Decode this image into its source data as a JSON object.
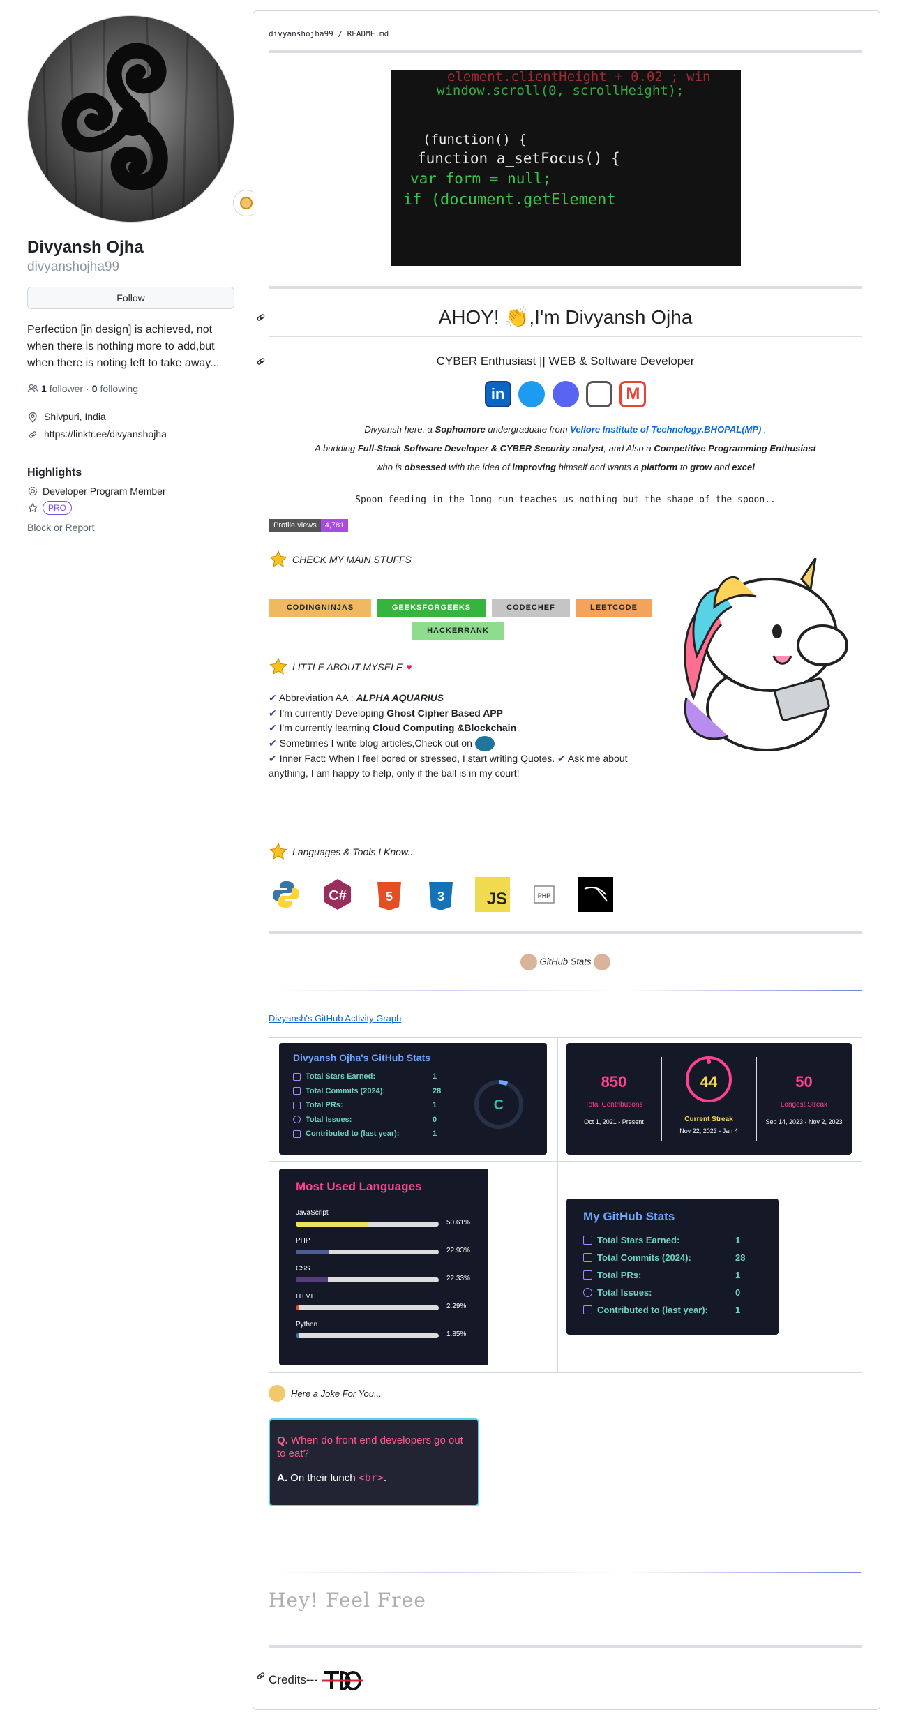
{
  "profile": {
    "full_name": "Divyansh Ojha",
    "login": "divyanshojha99",
    "follow_label": "Follow",
    "bio": "Perfection [in design] is achieved, not when there is nothing more to add,but when there is noting left to take away...",
    "followers_count": "1",
    "followers_label": "follower",
    "following_count": "0",
    "following_label": "following",
    "location": "Shivpuri, India",
    "website": "https://linktr.ee/divyanshojha",
    "highlights_title": "Highlights",
    "highlight_dev": "Developer Program Member",
    "pro_badge": "PRO",
    "block_label": "Block or Report"
  },
  "readme": {
    "breadcrumb_user": "divyanshojha99",
    "breadcrumb_sep": "/",
    "breadcrumb_file": "README.md",
    "code_lines": [
      "element.clientHeight + 0.02 ; win",
      "window.scroll(0, scrollHeight);",
      "(function() {",
      "function a_setFocus() {",
      "var form = null;",
      "if (document.getElement"
    ],
    "heading": "AHOY! 👏,I'm Divyansh Ojha",
    "subheading": "CYBER Enthusiast || WEB & Software Developer",
    "intro1_a": "Divyansh here, a ",
    "intro1_b": "Sophomore",
    "intro1_c": " undergraduate from ",
    "intro1_link": "Vellore Institute of Technology,BHOPAL(MP)",
    "intro1_d": " .",
    "intro2_a": "A budding ",
    "intro2_b": "Full-Stack Software Developer & CYBER Security analyst",
    "intro2_c": ", and Also a ",
    "intro2_d": "Competitive Programming Enthusiast",
    "intro3_a": "who is ",
    "intro3_b": "obsessed",
    "intro3_c": " with the idea of ",
    "intro3_d": "improving",
    "intro3_e": " himself and wants a ",
    "intro3_f": "platform",
    "intro3_g": " to ",
    "intro3_h": "grow",
    "intro3_i": " and ",
    "intro3_j": "excel",
    "quote": "Spoon feeding in the long run teaches us nothing but the shape of the spoon..",
    "views_label": "Profile views",
    "views_count": "4,781",
    "main_stuffs": "CHECK MY MAIN STUFFS",
    "badges": [
      "CODINGNINJAS",
      "GEEKSFORGEEKS",
      "CODECHEF",
      "LEETCODE",
      "HACKERRANK"
    ],
    "about_title": "LITTLE ABOUT MYSELF",
    "about_1a": "Abbreviation AA : ",
    "about_1b": "ALPHA AQUARIUS",
    "about_2a": "I'm currently Developing ",
    "about_2b": "Ghost Cipher Based APP",
    "about_3a": "I'm currently learning ",
    "about_3b": "Cloud Computing &Blockchain",
    "about_4": "Sometimes I write blog articles,Check out on",
    "about_5": "Inner Fact: When I feel bored or stressed, I start writing Quotes.",
    "about_6": "Ask me about anything, I am happy to help, only if the ball is in my court!",
    "tools_title": "Languages & Tools I Know...",
    "tools": [
      "Python",
      "C#",
      "HTML",
      "CSS",
      "JS",
      "PHP",
      "Kali"
    ],
    "github_stats": "GitHub Stats",
    "activity_link": "Divyansh's GitHub Activity Graph",
    "joke_title": "Here a Joke For You...",
    "joke_q_label": "Q.",
    "joke_q": "When do front end developers go out to eat?",
    "joke_a_label": "A.",
    "joke_a": "On their lunch",
    "joke_a_code": "<br>",
    "joke_a_end": ".",
    "hey": "Hey! Feel Free",
    "credits": "Credits---"
  },
  "stats_card": {
    "title": "Divyansh Ojha's GitHub Stats",
    "rows": [
      {
        "label": "Total Stars Earned:",
        "value": "1"
      },
      {
        "label": "Total Commits (2024):",
        "value": "28"
      },
      {
        "label": "Total PRs:",
        "value": "1"
      },
      {
        "label": "Total Issues:",
        "value": "0"
      },
      {
        "label": "Contributed to (last year):",
        "value": "1"
      }
    ],
    "grade": "C"
  },
  "streak_card": {
    "total": "850",
    "total_label": "Total Contributions",
    "total_range": "Oct 1, 2021 - Present",
    "current": "44",
    "current_label": "Current Streak",
    "current_range": "Nov 22, 2023 - Jan 4",
    "longest": "50",
    "longest_label": "Longest Streak",
    "longest_range": "Sep 14, 2023 - Nov 2, 2023"
  },
  "langs_card": {
    "title": "Most Used Languages",
    "langs": [
      {
        "name": "JavaScript",
        "pct": "50.61%",
        "frac": 0.5061,
        "color": "#f1e05a"
      },
      {
        "name": "PHP",
        "pct": "22.93%",
        "frac": 0.2293,
        "color": "#4f5d95"
      },
      {
        "name": "CSS",
        "pct": "22.33%",
        "frac": 0.2233,
        "color": "#563d7c"
      },
      {
        "name": "HTML",
        "pct": "2.29%",
        "frac": 0.0229,
        "color": "#e34c26"
      },
      {
        "name": "Python",
        "pct": "1.85%",
        "frac": 0.0185,
        "color": "#3572a5"
      }
    ]
  },
  "my_stats_card": {
    "title": "My GitHub Stats",
    "rows": [
      {
        "label": "Total Stars Earned:",
        "value": "1"
      },
      {
        "label": "Total Commits (2024):",
        "value": "28"
      },
      {
        "label": "Total PRs:",
        "value": "1"
      },
      {
        "label": "Total Issues:",
        "value": "0"
      },
      {
        "label": "Contributed to (last year):",
        "value": "1"
      }
    ]
  },
  "colors": {
    "stats_title": "#70a5fd",
    "stats_label": "#38bdae",
    "streak_accent": "#fe428e",
    "streak_yellow": "#f8d847",
    "langs_title": "#fe428e"
  }
}
